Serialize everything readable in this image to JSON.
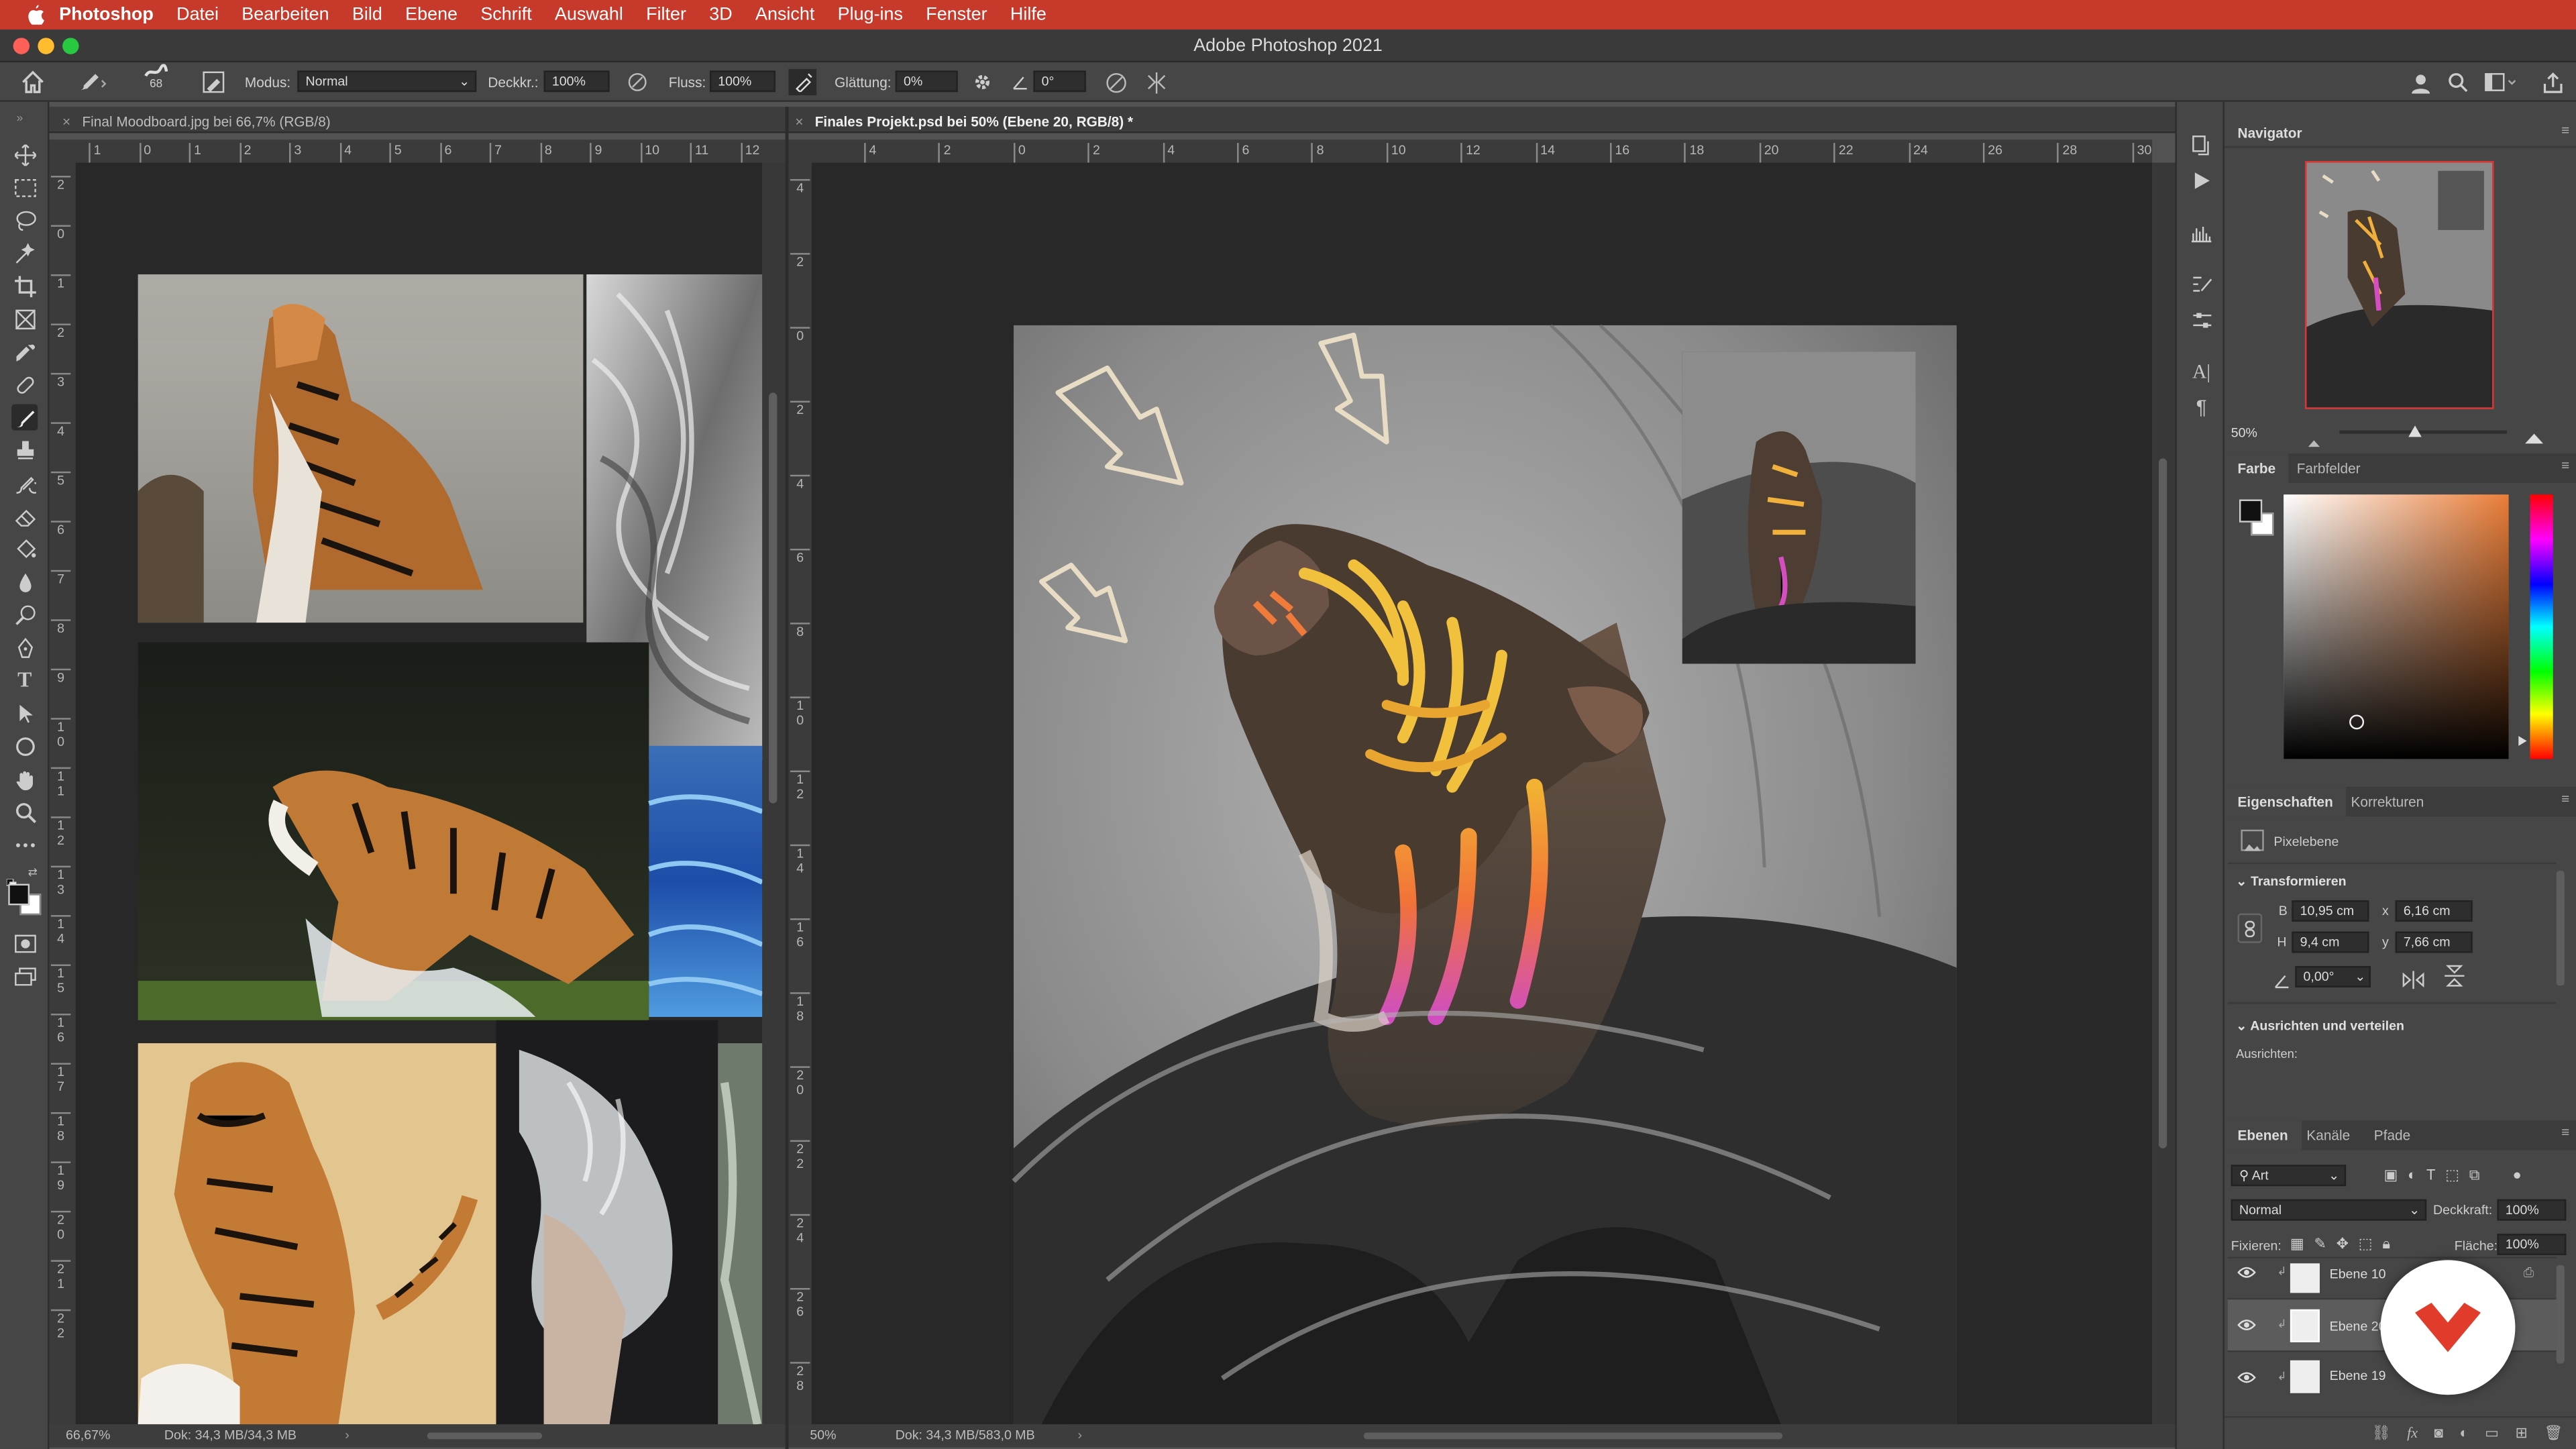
{
  "menubar": {
    "app": "Photoshop",
    "items": [
      "Datei",
      "Bearbeiten",
      "Bild",
      "Ebene",
      "Schrift",
      "Auswahl",
      "Filter",
      "3D",
      "Ansicht",
      "Plug-ins",
      "Fenster",
      "Hilfe"
    ]
  },
  "window": {
    "title": "Adobe Photoshop 2021"
  },
  "options": {
    "brush_size": "68",
    "mode_label": "Modus:",
    "mode_value": "Normal",
    "opacity_label": "Deckkr.:",
    "opacity_value": "100%",
    "flow_label": "Fluss:",
    "flow_value": "100%",
    "smoothing_label": "Glättung:",
    "smoothing_value": "0%",
    "angle_value": "0°"
  },
  "left_doc": {
    "tab": "Final Moodboard.jpg bei 66,7% (RGB/8)",
    "ruler_h": [
      "1",
      "0",
      "1",
      "2",
      "3",
      "4",
      "5",
      "6",
      "7",
      "8",
      "9",
      "10",
      "11",
      "12"
    ],
    "ruler_v": [
      "2",
      "0",
      "1",
      "2",
      "3",
      "4",
      "5",
      "6",
      "7",
      "8",
      "9",
      "1\n0",
      "1\n1",
      "1\n2",
      "1\n3",
      "1\n4",
      "1\n5",
      "1\n6",
      "1\n7",
      "1\n8",
      "1\n9",
      "2\n0",
      "2\n1",
      "2\n2"
    ],
    "zoom": "66,67%",
    "doc_size": "Dok: 34,3 MB/34,3 MB"
  },
  "right_doc": {
    "tab": "Finales Projekt.psd bei 50% (Ebene 20, RGB/8) *",
    "ruler_h": [
      "4",
      "2",
      "0",
      "2",
      "4",
      "6",
      "8",
      "10",
      "12",
      "14",
      "16",
      "18",
      "20",
      "22",
      "24",
      "26",
      "28",
      "30"
    ],
    "ruler_v": [
      "4",
      "2",
      "0",
      "2",
      "4",
      "6",
      "8",
      "1\n0",
      "1\n2",
      "1\n4",
      "1\n6",
      "1\n8",
      "2\n0",
      "2\n2",
      "2\n4",
      "2\n6",
      "2\n8"
    ],
    "zoom": "50%",
    "doc_size": "Dok: 34,3 MB/583,0 MB"
  },
  "navigator": {
    "title": "Navigator",
    "zoom": "50%"
  },
  "color": {
    "tab_active": "Farbe",
    "tab_other": "Farbfelder"
  },
  "properties": {
    "tab_active": "Eigenschaften",
    "tab_other": "Korrekturen",
    "layer_type": "Pixelebene",
    "section_transform": "Transformieren",
    "w_label": "B",
    "w_value": "10,95 cm",
    "x_label": "x",
    "x_value": "6,16 cm",
    "h_label": "H",
    "h_value": "9,4 cm",
    "y_label": "y",
    "y_value": "7,66 cm",
    "angle_value": "0,00°",
    "section_align": "Ausrichten und verteilen",
    "align_label": "Ausrichten:"
  },
  "layers": {
    "tab_active": "Ebenen",
    "tab_channels": "Kanäle",
    "tab_paths": "Pfade",
    "filter_kind": "Art",
    "blend_mode": "Normal",
    "opacity_label": "Deckkraft:",
    "opacity_value": "100%",
    "lock_label": "Fixieren:",
    "fill_label": "Fläche:",
    "fill_value": "100%",
    "items": [
      {
        "name": "Ebene 10"
      },
      {
        "name": "Ebene 20"
      },
      {
        "name": "Ebene 19"
      }
    ]
  },
  "colors": {
    "menubar": "#c7392a",
    "accent": "#e03b2b"
  }
}
